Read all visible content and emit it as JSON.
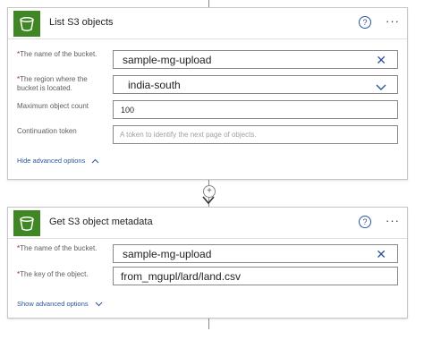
{
  "action1": {
    "title": "List S3 objects",
    "fields": [
      {
        "label": "The name of the bucket.",
        "required": true,
        "value": "sample-mg-upload"
      },
      {
        "label": "The region where the bucket is located.",
        "required": true,
        "value": "india-south"
      },
      {
        "label": "Maximum object count",
        "required": false,
        "value": "100"
      },
      {
        "label": "Continuation token",
        "required": false,
        "placeholder": "A token to identify the next page of objects."
      }
    ],
    "advanced_link": "Hide advanced options"
  },
  "connector": {
    "add_symbol": "+"
  },
  "action2": {
    "title": "Get S3 object metadata",
    "fields": [
      {
        "label": "The name of the bucket.",
        "required": true,
        "value": "sample-mg-upload"
      },
      {
        "label": "The key of the object.",
        "required": true,
        "value": "from_mgupl/lard/land.csv"
      }
    ],
    "advanced_link": "Show advanced options"
  },
  "common": {
    "required_marker": "*",
    "help_symbol": "?",
    "more_symbol": "···",
    "clear_symbol": "✕"
  },
  "colors": {
    "accent": "#2b5797",
    "brand": "#3f8624",
    "required": "#a4262c"
  }
}
